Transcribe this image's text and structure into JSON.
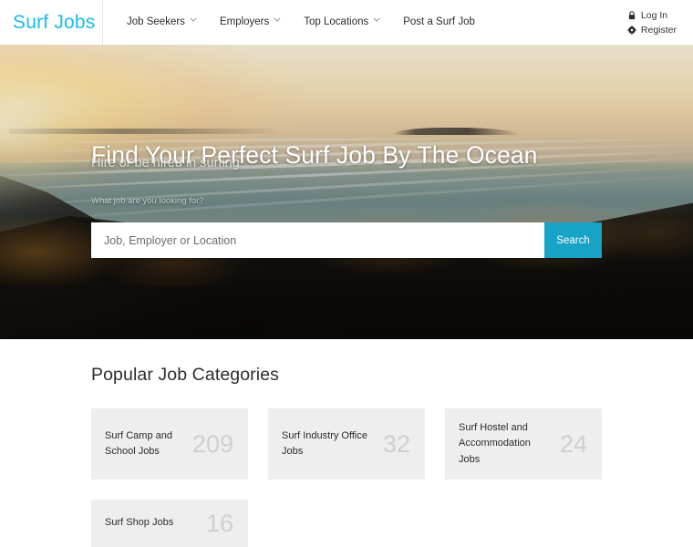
{
  "header": {
    "brand": "Surf Jobs",
    "nav": [
      {
        "label": "Job Seekers",
        "has_caret": true
      },
      {
        "label": "Employers",
        "has_caret": true
      },
      {
        "label": "Top Locations",
        "has_caret": true
      },
      {
        "label": "Post a Surf Job",
        "has_caret": false
      }
    ],
    "account": [
      {
        "label": "Log In",
        "icon": "lock-icon"
      },
      {
        "label": "Register",
        "icon": "gear-icon"
      }
    ]
  },
  "hero": {
    "title": "Find Your Perfect Surf Job By The Ocean",
    "subtitle": "Hire or be hired in surfing",
    "search_label": "What job are you looking for?",
    "search_placeholder": "Job, Employer or Location",
    "search_value": "",
    "search_button": "Search"
  },
  "categories": {
    "title": "Popular Job Categories",
    "items": [
      {
        "name": "Surf Camp and School Jobs",
        "count": "209"
      },
      {
        "name": "Surf Industry Office Jobs",
        "count": "32"
      },
      {
        "name": "Surf Hostel and Accommodation Jobs",
        "count": "24"
      },
      {
        "name": "Surf Shop Jobs",
        "count": "16"
      }
    ]
  },
  "colors": {
    "brand_cyan": "#17bde8",
    "button_blue": "#17a2c8",
    "card_bg": "#eeeeee",
    "count_gray": "#cfcfcf",
    "page_bg": "#ffffff"
  }
}
